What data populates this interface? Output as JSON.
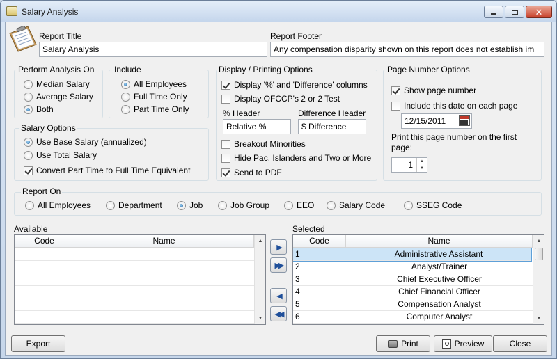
{
  "window": {
    "title": "Salary Analysis",
    "icon": "salary-analysis-app-icon",
    "controls": [
      "minimize-icon",
      "maximize-icon",
      "close-icon"
    ]
  },
  "report": {
    "title_label": "Report Title",
    "title_value": "Salary Analysis",
    "footer_label": "Report Footer",
    "footer_value": "Any compensation disparity shown on this report does not establish im"
  },
  "perform_analysis": {
    "label": "Perform Analysis On",
    "options": [
      "Median Salary",
      "Average Salary",
      "Both"
    ],
    "selected": "Both"
  },
  "include": {
    "label": "Include",
    "options": [
      "All Employees",
      "Full Time Only",
      "Part Time Only"
    ],
    "selected": "All Employees"
  },
  "salary_options": {
    "label": "Salary Options",
    "options": [
      "Use Base Salary (annualized)",
      "Use Total Salary"
    ],
    "selected": "Use Base Salary (annualized)",
    "convert_label": "Convert Part Time to Full Time Equivalent",
    "convert_checked": true
  },
  "display": {
    "label": "Display / Printing Options",
    "display_pct": "Display '%' and 'Difference' columns",
    "display_ofccp": "Display OFCCP's 2 or 2 Test",
    "pct_header_label": "% Header",
    "pct_header_value": "Relative %",
    "diff_header_label": "Difference Header",
    "diff_header_value": "$ Difference",
    "breakout": "Breakout Minorities",
    "hide_pac": "Hide Pac. Islanders and Two or More",
    "send_pdf": "Send to PDF"
  },
  "page_number": {
    "label": "Page Number Options",
    "show_label": "Show page number",
    "include_date_label": "Include this date on each page",
    "date_value": "12/15/2011",
    "print_first_label": "Print this page number on the first page:",
    "first_page_value": "1"
  },
  "report_on": {
    "label": "Report On",
    "options": [
      "All Employees",
      "Department",
      "Job",
      "Job Group",
      "EEO",
      "Salary Code",
      "SSEG Code"
    ],
    "selected": "Job"
  },
  "available": {
    "label": "Available",
    "col_code": "Code",
    "col_name": "Name"
  },
  "selected_list": {
    "label": "Selected",
    "col_code": "Code",
    "col_name": "Name",
    "rows": [
      {
        "code": "1",
        "name": "Administrative Assistant"
      },
      {
        "code": "2",
        "name": "Analyst/Trainer"
      },
      {
        "code": "3",
        "name": "Chief Executive Officer"
      },
      {
        "code": "4",
        "name": "Chief Financial Officer"
      },
      {
        "code": "5",
        "name": "Compensation Analyst"
      },
      {
        "code": "6",
        "name": "Computer Analyst"
      }
    ]
  },
  "buttons": {
    "export": "Export",
    "print": "Print",
    "preview": "Preview",
    "close": "Close"
  }
}
